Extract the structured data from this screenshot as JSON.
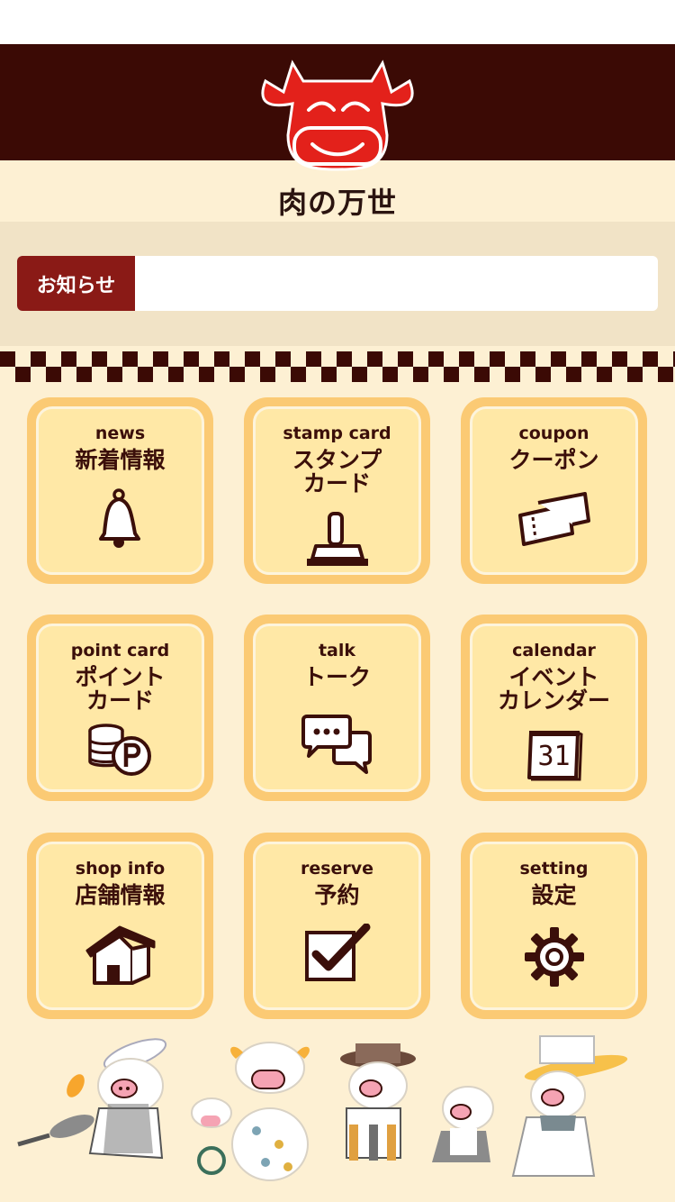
{
  "brand": {
    "name": "肉の万世"
  },
  "notice": {
    "label": "お知らせ",
    "text": ""
  },
  "menu": [
    {
      "en": "news",
      "jp": "新着情報",
      "icon": "bell-icon"
    },
    {
      "en": "stamp card",
      "jp": "スタンプ\nカード",
      "icon": "stamp-icon"
    },
    {
      "en": "coupon",
      "jp": "クーポン",
      "icon": "coupon-icon"
    },
    {
      "en": "point card",
      "jp": "ポイント\nカード",
      "icon": "coins-icon"
    },
    {
      "en": "talk",
      "jp": "トーク",
      "icon": "chat-bubbles-icon"
    },
    {
      "en": "calendar",
      "jp": "イベント\nカレンダー",
      "icon": "calendar-icon"
    },
    {
      "en": "shop info",
      "jp": "店舗情報",
      "icon": "house-icon"
    },
    {
      "en": "reserve",
      "jp": "予約",
      "icon": "checkbox-icon"
    },
    {
      "en": "setting",
      "jp": "設定",
      "icon": "gear-icon"
    }
  ],
  "calendar_day": "31",
  "colors": {
    "header": "#3b0a05",
    "accent": "#8a1a16",
    "tile_outer": "#fbca74",
    "tile_inner": "#ffe8a6",
    "background": "#fdf0d3"
  }
}
